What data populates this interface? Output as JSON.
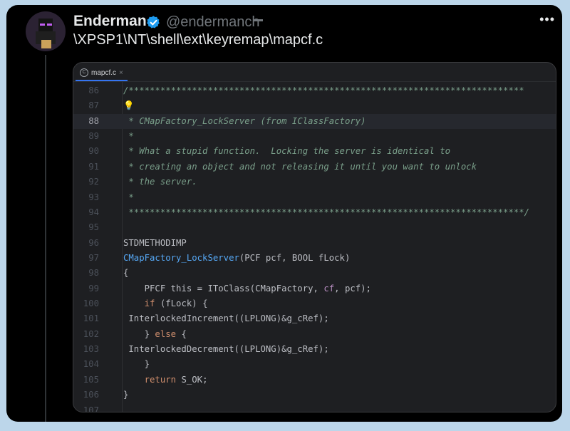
{
  "tweet": {
    "author_name": "Enderman",
    "handle": "@endermanch",
    "text": "\\XPSP1\\NT\\shell\\ext\\keyremap\\mapcf.c",
    "more": "•••"
  },
  "editor": {
    "tab": {
      "label": "mapcf.c",
      "close": "×",
      "icon": "C"
    },
    "current_line": "88",
    "lines": [
      {
        "n": "86",
        "segs": [
          {
            "t": "/***************************************************************************",
            "c": "cm"
          }
        ]
      },
      {
        "n": "87",
        "segs": [
          {
            "t": "💡",
            "c": "bulb"
          }
        ]
      },
      {
        "n": "88",
        "segs": [
          {
            "t": " * CMapFactory_LockServer (from IClassFactory)",
            "c": "cm"
          }
        ]
      },
      {
        "n": "89",
        "segs": [
          {
            "t": " *",
            "c": "cm"
          }
        ]
      },
      {
        "n": "90",
        "segs": [
          {
            "t": " * What a stupid function.  Locking the server is identical to",
            "c": "cm"
          }
        ]
      },
      {
        "n": "91",
        "segs": [
          {
            "t": " * creating an object and not releasing it until you want to unlock",
            "c": "cm"
          }
        ]
      },
      {
        "n": "92",
        "segs": [
          {
            "t": " * the server.",
            "c": "cm"
          }
        ]
      },
      {
        "n": "93",
        "segs": [
          {
            "t": " *",
            "c": "cm"
          }
        ]
      },
      {
        "n": "94",
        "segs": [
          {
            "t": " ***************************************************************************/",
            "c": "cm"
          }
        ]
      },
      {
        "n": "95",
        "segs": [
          {
            "t": "",
            "c": ""
          }
        ]
      },
      {
        "n": "96",
        "segs": [
          {
            "t": "STDMETHODIMP",
            "c": ""
          }
        ]
      },
      {
        "n": "97",
        "segs": [
          {
            "t": "CMapFactory_LockServer",
            "c": "fn"
          },
          {
            "t": "(PCF pcf, BOOL fLock)",
            "c": ""
          }
        ]
      },
      {
        "n": "98",
        "segs": [
          {
            "t": "{",
            "c": ""
          }
        ]
      },
      {
        "n": "99",
        "segs": [
          {
            "t": "    PFCF this = IToClass(CMapFactory, ",
            "c": ""
          },
          {
            "t": "cf",
            "c": "param"
          },
          {
            "t": ", pcf);",
            "c": ""
          }
        ]
      },
      {
        "n": "100",
        "segs": [
          {
            "t": "    ",
            "c": ""
          },
          {
            "t": "if",
            "c": "kw"
          },
          {
            "t": " (fLock) {",
            "c": ""
          }
        ]
      },
      {
        "n": "101",
        "segs": [
          {
            "t": " InterlockedIncrement((LPLONG)&g_cRef);",
            "c": ""
          }
        ]
      },
      {
        "n": "102",
        "segs": [
          {
            "t": "    } ",
            "c": ""
          },
          {
            "t": "else",
            "c": "kw"
          },
          {
            "t": " {",
            "c": ""
          }
        ]
      },
      {
        "n": "103",
        "segs": [
          {
            "t": " InterlockedDecrement((LPLONG)&g_cRef);",
            "c": ""
          }
        ]
      },
      {
        "n": "104",
        "segs": [
          {
            "t": "    }",
            "c": ""
          }
        ]
      },
      {
        "n": "105",
        "segs": [
          {
            "t": "    ",
            "c": ""
          },
          {
            "t": "return",
            "c": "kw"
          },
          {
            "t": " S_OK;",
            "c": ""
          }
        ]
      },
      {
        "n": "106",
        "segs": [
          {
            "t": "}",
            "c": ""
          }
        ]
      },
      {
        "n": "107",
        "segs": [
          {
            "t": "",
            "c": ""
          }
        ]
      }
    ]
  },
  "colors": {
    "background": "#bcd6ea",
    "card": "#000000",
    "editor_bg": "#1e1f22",
    "verified": "#1d9bf0",
    "comment": "#7a9f8a",
    "keyword": "#cf8e6d",
    "function": "#56a8f5"
  },
  "icons": {
    "verified": "verified-badge-icon",
    "more": "more-options-icon",
    "avatar": "enderman-avatar",
    "file": "c-file-icon",
    "bulb": "lightbulb-icon"
  }
}
